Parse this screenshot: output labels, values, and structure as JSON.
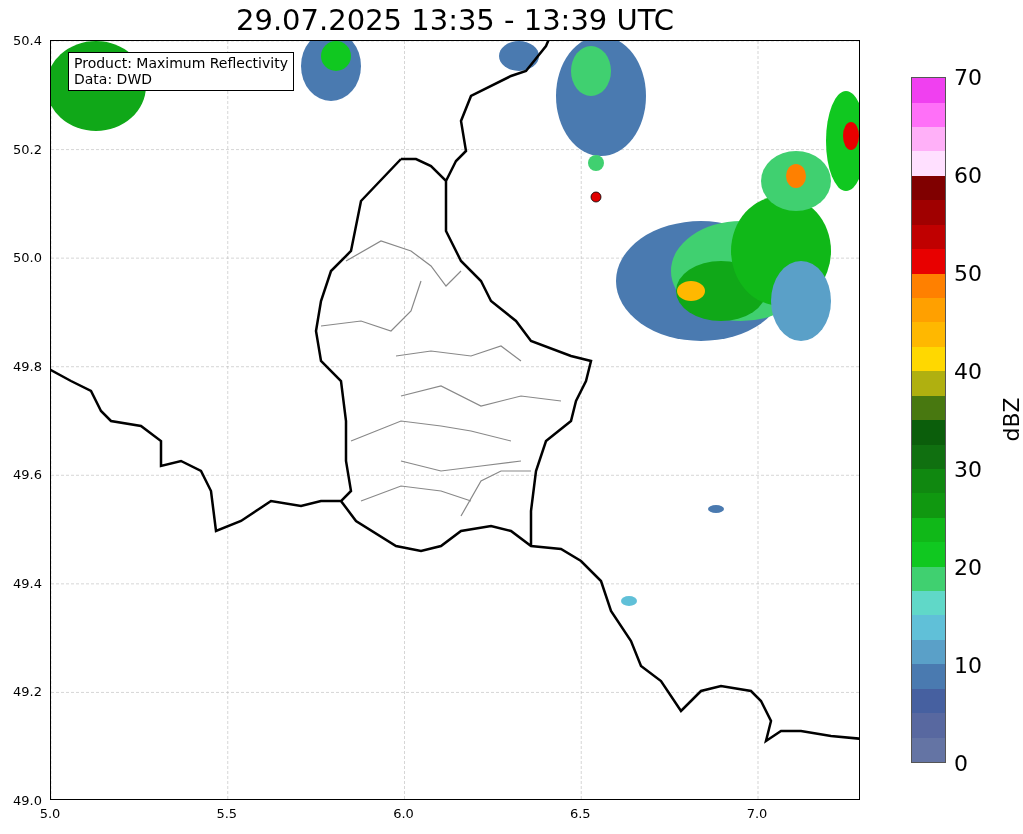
{
  "title": "29.07.2025 13:35 - 13:39 UTC",
  "info_box": [
    "Product: Maximum Reflectivity",
    "Data: DWD"
  ],
  "x_ticks": [
    "5.0",
    "5.5",
    "6.0",
    "6.5",
    "7.0"
  ],
  "y_ticks": [
    "50.4",
    "50.2",
    "50.0",
    "49.8",
    "49.6",
    "49.4",
    "49.2",
    "49.0"
  ],
  "colorbar": {
    "label": "dBZ",
    "ticks": [
      "70",
      "60",
      "50",
      "40",
      "30",
      "20",
      "10",
      "0"
    ],
    "segments": [
      {
        "color": "#6474a4"
      },
      {
        "color": "#5868a0"
      },
      {
        "color": "#4660a0"
      },
      {
        "color": "#4a7ab0"
      },
      {
        "color": "#5aa0c8"
      },
      {
        "color": "#60c0d8"
      },
      {
        "color": "#60d8c8"
      },
      {
        "color": "#40d070"
      },
      {
        "color": "#10c820"
      },
      {
        "color": "#10b818"
      },
      {
        "color": "#109810"
      },
      {
        "color": "#108810"
      },
      {
        "color": "#107010"
      },
      {
        "color": "#0b5e0b"
      },
      {
        "color": "#487810"
      },
      {
        "color": "#b0b010"
      },
      {
        "color": "#ffd800"
      },
      {
        "color": "#ffb800"
      },
      {
        "color": "#ffa000"
      },
      {
        "color": "#ff8000"
      },
      {
        "color": "#e80000"
      },
      {
        "color": "#c00000"
      },
      {
        "color": "#a00000"
      },
      {
        "color": "#800000"
      },
      {
        "color": "#ffe0ff"
      },
      {
        "color": "#ffb0f8"
      },
      {
        "color": "#ff70f8"
      },
      {
        "color": "#f040f0"
      }
    ]
  }
}
